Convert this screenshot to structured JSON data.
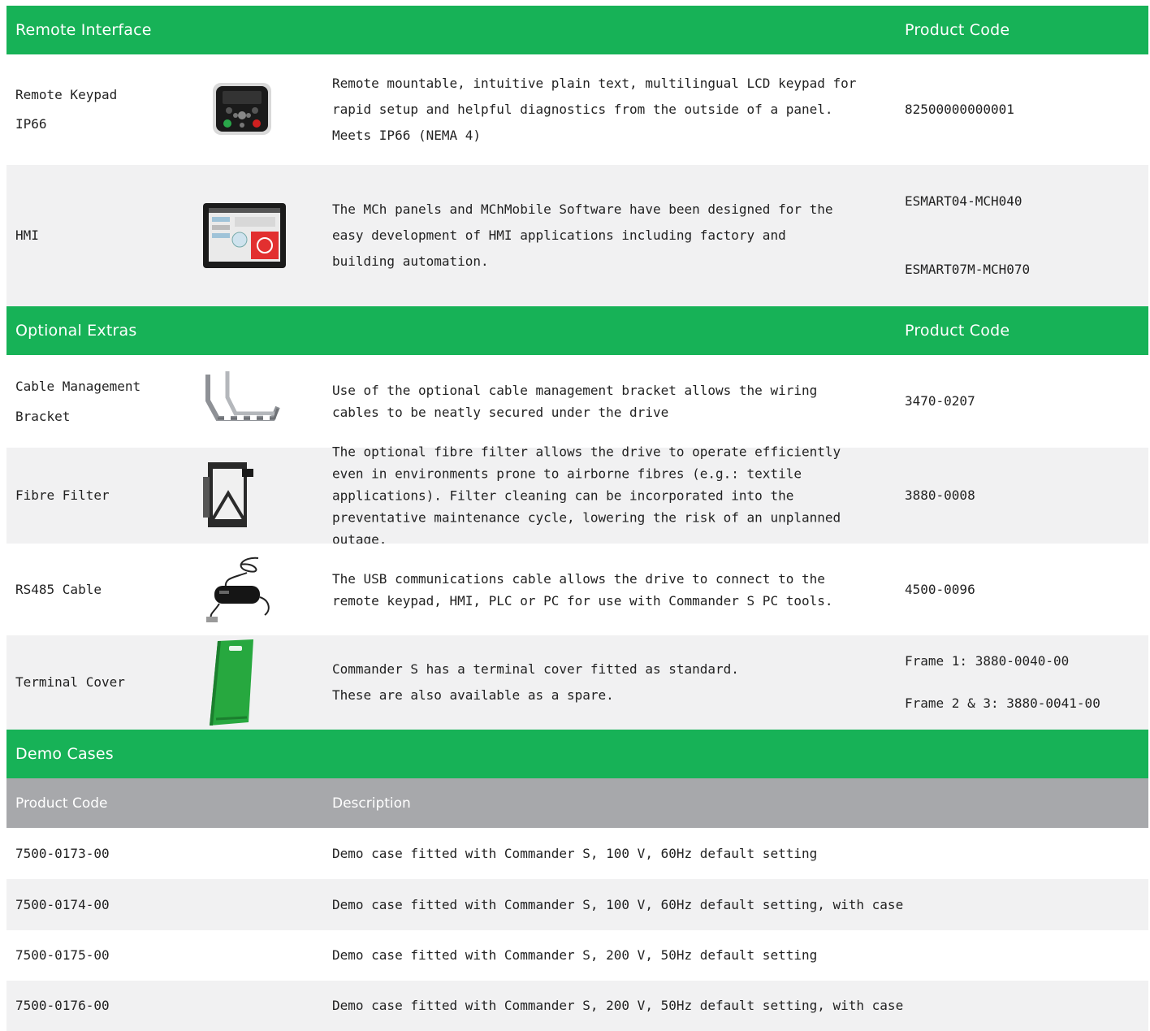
{
  "remote_interface": {
    "header": "Remote Interface",
    "code_header": "Product Code",
    "rows": [
      {
        "name": "Remote Keypad IP66",
        "image_icon": "remote-keypad-icon",
        "description": "Remote mountable, intuitive plain text, multilingual LCD keypad for rapid setup and helpful diagnostics from the outside of a panel. Meets IP66 (NEMA 4)",
        "codes": [
          "82500000000001"
        ]
      },
      {
        "name": "HMI",
        "image_icon": "hmi-panel-icon",
        "description": "The MCh panels and MChMobile Software have been designed for the easy development of HMI applications including factory and building automation.",
        "codes": [
          "ESMART04-MCH040",
          "ESMART07M-MCH070"
        ]
      }
    ]
  },
  "optional_extras": {
    "header": "Optional Extras",
    "code_header": "Product Code",
    "rows": [
      {
        "name": "Cable Management Bracket",
        "image_icon": "cable-bracket-icon",
        "description": "Use of the optional cable management bracket allows the wiring cables to be neatly secured under the drive",
        "codes": [
          "3470-0207"
        ]
      },
      {
        "name": "Fibre Filter",
        "image_icon": "fibre-filter-icon",
        "description": "The optional fibre filter allows the drive to operate efficiently even in environments prone to airborne fibres (e.g.: textile applications).  Filter cleaning can be incorporated into the preventative maintenance cycle, lowering the risk of an unplanned outage.",
        "codes": [
          "3880-0008"
        ]
      },
      {
        "name": "RS485 Cable",
        "image_icon": "usb-cable-icon",
        "description": "The USB communications cable allows the drive to connect to the remote keypad, HMI, PLC or PC for use with Commander S PC tools.",
        "codes": [
          "4500-0096"
        ]
      },
      {
        "name": "Terminal Cover",
        "image_icon": "terminal-cover-icon",
        "description_lines": [
          "Commander S has a terminal cover fitted as standard.",
          "These are also available as a spare."
        ],
        "codes": [
          "Frame 1: 3880-0040-00",
          "Frame 2 & 3: 3880-0041-00"
        ]
      }
    ]
  },
  "demo_cases": {
    "header": "Demo Cases",
    "columns": [
      "Product Code",
      "Description"
    ],
    "rows": [
      {
        "code": "7500-0173-00",
        "description": "Demo case fitted with Commander S, 100 V, 60Hz default setting"
      },
      {
        "code": "7500-0174-00",
        "description": "Demo case fitted with Commander S, 100 V, 60Hz default setting, with case"
      },
      {
        "code": "7500-0175-00",
        "description": "Demo case fitted with Commander S, 200 V, 50Hz default setting"
      },
      {
        "code": "7500-0176-00",
        "description": "Demo case fitted with Commander S, 200 V, 50Hz default setting, with case"
      }
    ]
  },
  "colors": {
    "header_green": "#17b257",
    "subheader_grey": "#a7a8ab",
    "row_alt": "#f1f1f2",
    "cover_green": "#27a83f"
  }
}
